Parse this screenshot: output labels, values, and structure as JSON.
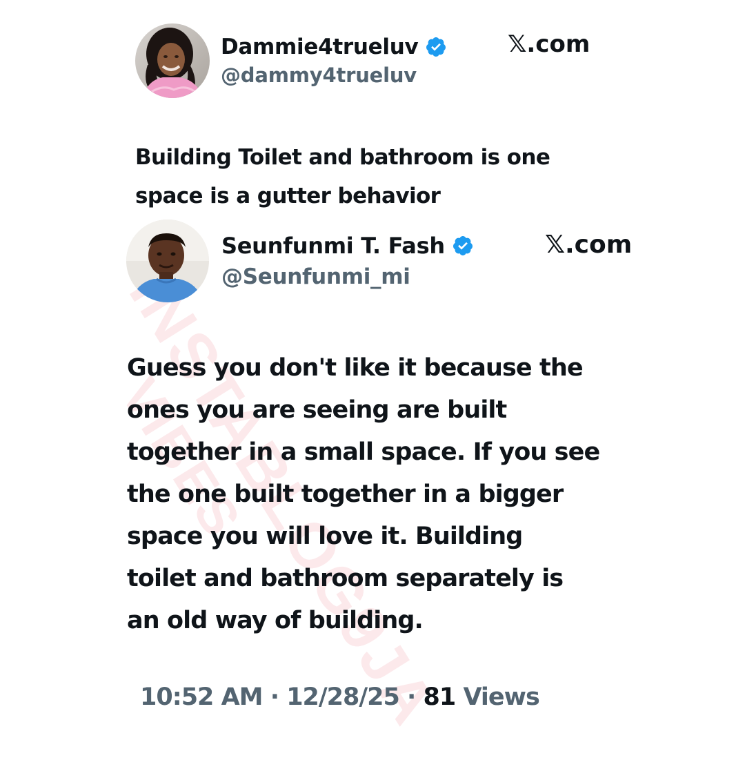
{
  "watermark": {
    "line1": "INSTABLOG9JA",
    "line2": "VIBES"
  },
  "tweets": [
    {
      "display_name": "Dammie4trueluv",
      "handle": "@dammy4trueluv",
      "verified": true,
      "site": "𝕏.com",
      "avatar_icon": "woman-portrait-avatar",
      "text_lines": [
        "Building Toilet and bathroom is one",
        "space is a gutter behavior"
      ]
    },
    {
      "display_name": "Seunfunmi T. Fash",
      "handle": "@Seunfunmi_mi",
      "verified": true,
      "site": "𝕏.com",
      "avatar_icon": "man-portrait-avatar",
      "text_lines": [
        "Guess you don't like it because the",
        "ones you are seeing are built",
        "together in a small space. If you see",
        "the one built together in a bigger",
        "space you will love it. Building",
        "toilet and bathroom separately is",
        "an old way of building."
      ]
    }
  ],
  "meta": {
    "time": "10:52 AM",
    "separator": " · ",
    "date": "12/28/25",
    "views_count": "81",
    "views_label": "Views"
  },
  "colors": {
    "verified_blue": "#1d9bf0",
    "text_primary": "#0f1419",
    "text_secondary": "#536471",
    "watermark": "#eb7882"
  }
}
